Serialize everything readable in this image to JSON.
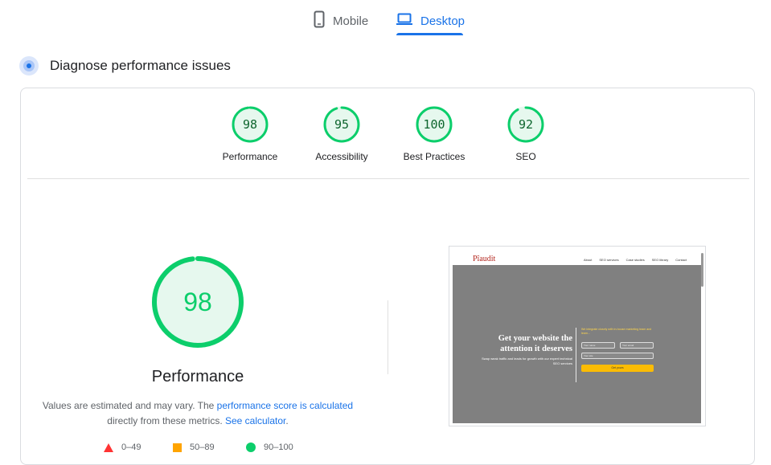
{
  "tabs": {
    "mobile": {
      "label": "Mobile",
      "icon": "phone-icon"
    },
    "desktop": {
      "label": "Desktop",
      "icon": "laptop-icon",
      "selected": true
    }
  },
  "section": {
    "title": "Diagnose performance issues",
    "icon": "diagnose-icon"
  },
  "categories": [
    {
      "label": "Performance",
      "score": "98",
      "fraction": 0.98
    },
    {
      "label": "Accessibility",
      "score": "95",
      "fraction": 0.95
    },
    {
      "label": "Best Practices",
      "score": "100",
      "fraction": 1.0
    },
    {
      "label": "SEO",
      "score": "92",
      "fraction": 0.92
    }
  ],
  "performance": {
    "score": "98",
    "fraction": 0.98,
    "title": "Performance",
    "note_before": "Values are estimated and may vary. The ",
    "note_link": "performance score is calculated",
    "note_middle": " directly from these metrics. ",
    "note_link2": "See calculator",
    "note_end": "."
  },
  "legend": [
    {
      "range": "0–49",
      "shape": "triangle",
      "color": "#ff3333"
    },
    {
      "range": "50–89",
      "shape": "square",
      "color": "#ffa400"
    },
    {
      "range": "90–100",
      "shape": "circle",
      "color": "#0cce6b"
    }
  ],
  "colors": {
    "accent": "#1a73e8",
    "pass": "#0cce6b",
    "pass_text": "#0d652d"
  },
  "screenshot": {
    "logo": "Pîaudit",
    "nav": [
      "About",
      "SEO services",
      "Case studies",
      "SEO library",
      "Contact"
    ],
    "headline": "Get your website the attention it deserves",
    "subtext": "Swap weak traffic and leads for growth with our expert technical SEO services",
    "form_text": "We integrate closely with in-house marketing team and learn...",
    "name_placeholder": "Your name",
    "email_placeholder": "Your email",
    "site_placeholder": "Your site",
    "button": "Get yours"
  }
}
